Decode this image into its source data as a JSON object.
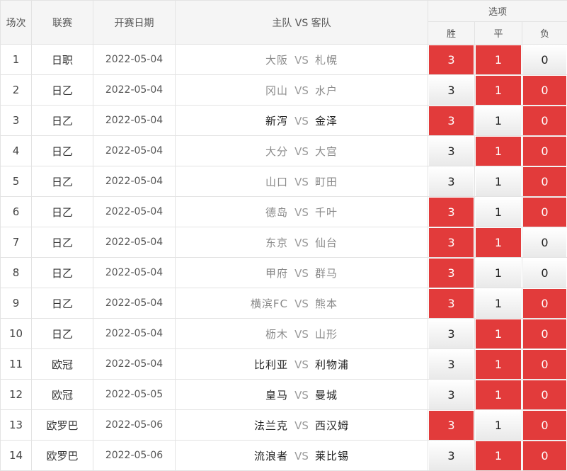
{
  "headers": {
    "index": "场次",
    "league": "联赛",
    "date": "开赛日期",
    "match": "主队 VS 客队",
    "options": "选项",
    "win": "胜",
    "draw": "平",
    "loss": "负"
  },
  "vs": "VS",
  "colors": {
    "selected": "#e23b3b",
    "header_bg": "#f5f5f5"
  },
  "rows": [
    {
      "idx": "1",
      "league": "日职",
      "date": "2022-05-04",
      "home": "大阪",
      "away": "札幌",
      "names_muted": true,
      "win": "3",
      "draw": "1",
      "loss": "0",
      "sel": {
        "win": true,
        "draw": true,
        "loss": false
      }
    },
    {
      "idx": "2",
      "league": "日乙",
      "date": "2022-05-04",
      "home": "冈山",
      "away": "水户",
      "names_muted": true,
      "win": "3",
      "draw": "1",
      "loss": "0",
      "sel": {
        "win": false,
        "draw": true,
        "loss": true
      }
    },
    {
      "idx": "3",
      "league": "日乙",
      "date": "2022-05-04",
      "home": "新泻",
      "away": "金泽",
      "names_muted": false,
      "win": "3",
      "draw": "1",
      "loss": "0",
      "sel": {
        "win": true,
        "draw": false,
        "loss": true
      }
    },
    {
      "idx": "4",
      "league": "日乙",
      "date": "2022-05-04",
      "home": "大分",
      "away": "大宫",
      "names_muted": true,
      "win": "3",
      "draw": "1",
      "loss": "0",
      "sel": {
        "win": false,
        "draw": true,
        "loss": true
      }
    },
    {
      "idx": "5",
      "league": "日乙",
      "date": "2022-05-04",
      "home": "山口",
      "away": "町田",
      "names_muted": true,
      "win": "3",
      "draw": "1",
      "loss": "0",
      "sel": {
        "win": false,
        "draw": false,
        "loss": true
      }
    },
    {
      "idx": "6",
      "league": "日乙",
      "date": "2022-05-04",
      "home": "德岛",
      "away": "千叶",
      "names_muted": true,
      "win": "3",
      "draw": "1",
      "loss": "0",
      "sel": {
        "win": true,
        "draw": false,
        "loss": true
      }
    },
    {
      "idx": "7",
      "league": "日乙",
      "date": "2022-05-04",
      "home": "东京",
      "away": "仙台",
      "names_muted": true,
      "win": "3",
      "draw": "1",
      "loss": "0",
      "sel": {
        "win": true,
        "draw": true,
        "loss": false
      }
    },
    {
      "idx": "8",
      "league": "日乙",
      "date": "2022-05-04",
      "home": "甲府",
      "away": "群马",
      "names_muted": true,
      "win": "3",
      "draw": "1",
      "loss": "0",
      "sel": {
        "win": true,
        "draw": false,
        "loss": false
      }
    },
    {
      "idx": "9",
      "league": "日乙",
      "date": "2022-05-04",
      "home": "横滨FC",
      "away": "熊本",
      "names_muted": true,
      "win": "3",
      "draw": "1",
      "loss": "0",
      "sel": {
        "win": true,
        "draw": false,
        "loss": true
      }
    },
    {
      "idx": "10",
      "league": "日乙",
      "date": "2022-05-04",
      "home": "枥木",
      "away": "山形",
      "names_muted": true,
      "win": "3",
      "draw": "1",
      "loss": "0",
      "sel": {
        "win": false,
        "draw": true,
        "loss": true
      }
    },
    {
      "idx": "11",
      "league": "欧冠",
      "date": "2022-05-04",
      "home": "比利亚",
      "away": "利物浦",
      "names_muted": false,
      "win": "3",
      "draw": "1",
      "loss": "0",
      "sel": {
        "win": false,
        "draw": true,
        "loss": true
      }
    },
    {
      "idx": "12",
      "league": "欧冠",
      "date": "2022-05-05",
      "home": "皇马",
      "away": "曼城",
      "names_muted": false,
      "win": "3",
      "draw": "1",
      "loss": "0",
      "sel": {
        "win": false,
        "draw": true,
        "loss": true
      }
    },
    {
      "idx": "13",
      "league": "欧罗巴",
      "date": "2022-05-06",
      "home": "法兰克",
      "away": "西汉姆",
      "names_muted": false,
      "win": "3",
      "draw": "1",
      "loss": "0",
      "sel": {
        "win": true,
        "draw": false,
        "loss": true
      }
    },
    {
      "idx": "14",
      "league": "欧罗巴",
      "date": "2022-05-06",
      "home": "流浪者",
      "away": "莱比锡",
      "names_muted": false,
      "win": "3",
      "draw": "1",
      "loss": "0",
      "sel": {
        "win": false,
        "draw": true,
        "loss": true
      }
    }
  ]
}
